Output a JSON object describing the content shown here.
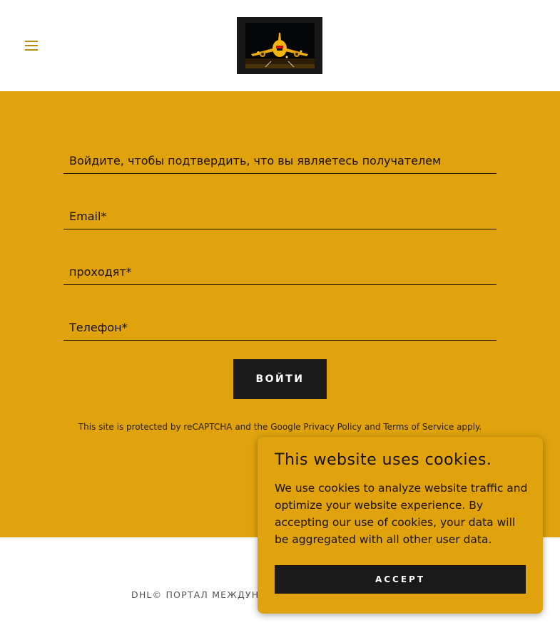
{
  "header": {
    "menu_icon": "hamburger-menu-icon",
    "logo_alt": "DHL cargo aircraft logo",
    "accent_color": "#b88a0a"
  },
  "form": {
    "intro_placeholder": "Войдите, чтобы подтвердить, что вы являетесь получателем",
    "email_placeholder": "Email*",
    "password_placeholder": "проходят*",
    "phone_placeholder": "Телефон*",
    "submit_label": "Войти",
    "background_color": "#e0a30d"
  },
  "recaptcha": {
    "prefix": "This site is protected by reCAPTCHA and the Google ",
    "privacy_link": "Privacy Policy",
    "middle": " and ",
    "terms_link": "Terms of Service",
    "suffix": " apply."
  },
  "footer": {
    "copyright": "DHL© ПОРТАЛ МЕЖДУНАРО"
  },
  "cookie_banner": {
    "title": "This website uses cookies.",
    "text": "We use cookies to analyze website traffic and optimize your website experience. By accepting our use of cookies, your data will be aggregated with all other user data.",
    "accept_label": "ACCEPT"
  }
}
